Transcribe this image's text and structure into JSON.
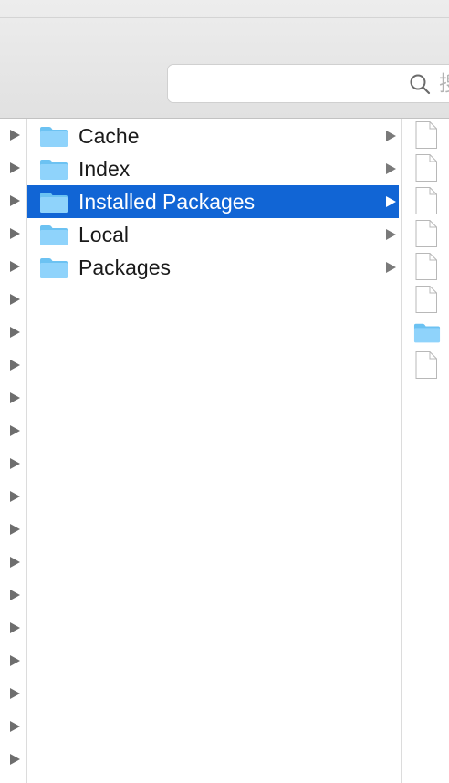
{
  "toolbar": {
    "search": {
      "placeholder": "搜",
      "icon": "search-icon"
    }
  },
  "parent_column": {
    "arrow_count": 20,
    "arrow_icon": "disclosure-arrow-icon"
  },
  "folder_column": {
    "items": [
      {
        "label": "Cache",
        "icon": "folder-icon",
        "selected": false
      },
      {
        "label": "Index",
        "icon": "folder-icon",
        "selected": false
      },
      {
        "label": "Installed Packages",
        "icon": "folder-icon",
        "selected": true
      },
      {
        "label": "Local",
        "icon": "folder-icon",
        "selected": false
      },
      {
        "label": "Packages",
        "icon": "folder-icon",
        "selected": false
      }
    ]
  },
  "preview_column": {
    "items": [
      {
        "kind": "file"
      },
      {
        "kind": "file"
      },
      {
        "kind": "file"
      },
      {
        "kind": "file"
      },
      {
        "kind": "file"
      },
      {
        "kind": "file"
      },
      {
        "kind": "folder"
      },
      {
        "kind": "file"
      }
    ]
  },
  "colors": {
    "selection": "#1165d5",
    "folder": "#8fd3fb",
    "folder_tab": "#6cc2f2"
  }
}
